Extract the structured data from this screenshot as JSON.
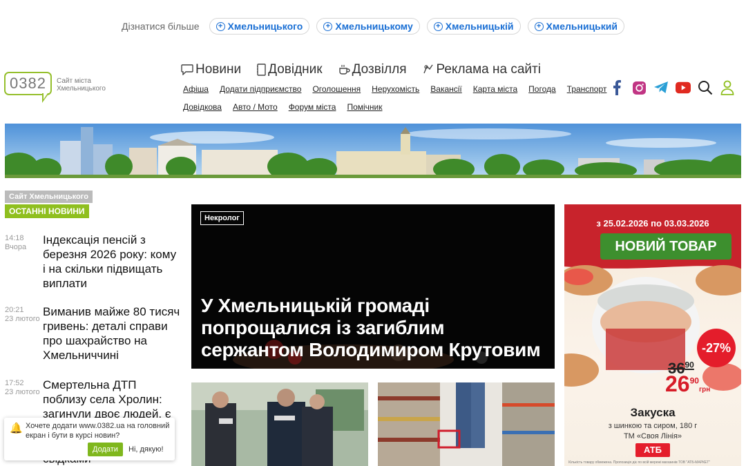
{
  "learn_more": {
    "label": "Дізнатися більше",
    "pills": [
      "Хмельницького",
      "Хмельницькому",
      "Хмельницькій",
      "Хмельницький"
    ]
  },
  "logo": {
    "code": "0382",
    "tagline": "Сайт міста Хмельницького"
  },
  "nav": {
    "main": [
      {
        "label": "Новини",
        "icon": "chat-icon"
      },
      {
        "label": "Довідник",
        "icon": "book-icon"
      },
      {
        "label": "Дозвілля",
        "icon": "cup-icon"
      },
      {
        "label": "Реклама на сайті",
        "icon": "megaphone-icon"
      }
    ],
    "sub_row1": [
      "Афіша",
      "Додати підприємство",
      "Оголошення",
      "Нерухомість",
      "Вакансії",
      "Карта міста",
      "Погода",
      "Транспорт"
    ],
    "sub_row2": [
      "Довідкова",
      "Авто / Мото",
      "Форум міста",
      "Помічник"
    ]
  },
  "social": {
    "icons": [
      "facebook-icon",
      "instagram-icon",
      "telegram-icon",
      "youtube-icon",
      "search-icon",
      "user-icon"
    ],
    "colors": {
      "facebook": "#3b5998",
      "instagram": "#c13584",
      "telegram": "#2a9fd6",
      "youtube": "#e02a20",
      "user": "#8fbf1f"
    }
  },
  "sidebar": {
    "site_tag": "Сайт Хмельницького",
    "section_tag": "ОСТАННІ НОВИНИ",
    "news": [
      {
        "time": "14:18",
        "date": "Вчора",
        "title": "Індексація пенсій з березня 2026 року: кому і на скільки підвищать виплати"
      },
      {
        "time": "20:21",
        "date": "23 лютого",
        "title": "Виманив майже 80 тисяч гривень: деталі справи про шахрайство на Хмельниччині"
      },
      {
        "time": "17:52",
        "date": "23 лютого",
        "title": "Смертельна ДТП поблизу села Хролин: загинули двоє людей, є травмовані"
      },
      {
        "time": "",
        "date": "",
        "title": "свідками"
      }
    ]
  },
  "featured": {
    "tag": "Некролог",
    "title": "У Хмельницькій громаді попрощалися із загиблим сержантом Володимиром Крутовим"
  },
  "ad": {
    "date_range": "з 25.02.2026 по 03.03.2026",
    "ribbon": "НОВИЙ ТОВАР",
    "old_price_main": "36",
    "old_price_cents": "90",
    "new_price_main": "26",
    "new_price_cents": "90",
    "currency": "грн",
    "discount": "-27%",
    "product_name": "Закуска",
    "product_desc_1": "з шинкою та сиром, 180 г",
    "product_desc_2": "ТМ «Своя Лінія»",
    "store": "АТБ",
    "fine_print": "Кількість товару обмежена. Пропозиція діє по всій мережі магазинів ТОВ \"АТБ-МАРКЕТ\""
  },
  "push": {
    "text": "Хочете додати www.0382.ua на головний екран і бути в курсі новин?",
    "yes": "Додати",
    "no": "Ні, дякую!"
  }
}
